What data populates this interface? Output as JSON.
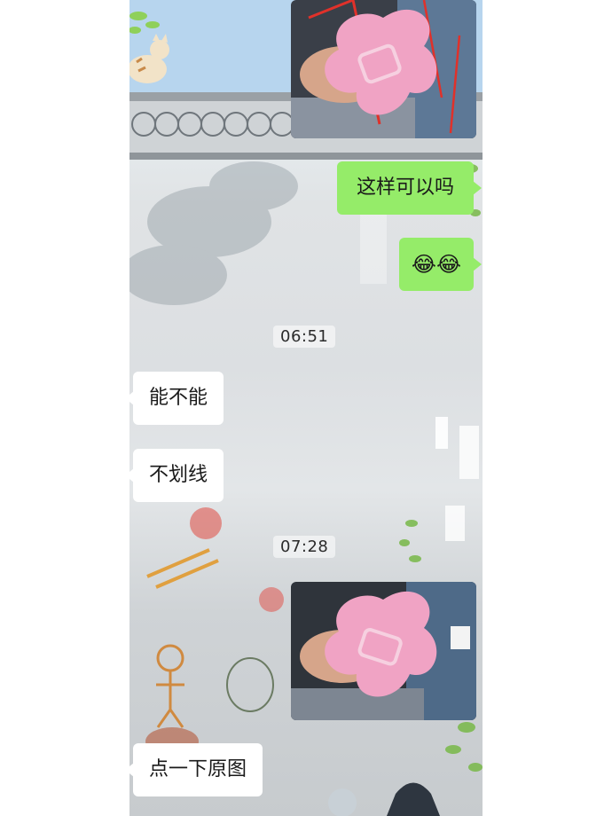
{
  "chat": {
    "messages": [
      {
        "kind": "image",
        "side": "out",
        "description_icon": "photo-with-sticker-icon"
      },
      {
        "kind": "text",
        "side": "out",
        "text": "这样可以吗"
      },
      {
        "kind": "emoji",
        "side": "out",
        "text": "😂😂"
      },
      {
        "kind": "time",
        "text": "06:51"
      },
      {
        "kind": "text",
        "side": "in",
        "text": "能不能"
      },
      {
        "kind": "text",
        "side": "in",
        "text": "不划线"
      },
      {
        "kind": "time",
        "text": "07:28"
      },
      {
        "kind": "image",
        "side": "out",
        "description_icon": "photo-with-sticker-icon"
      },
      {
        "kind": "text",
        "side": "in",
        "text": "点一下原图"
      }
    ]
  },
  "colors": {
    "outgoing_bubble": "#95ec69",
    "incoming_bubble": "#ffffff",
    "sticker_pink": "#f0a3c4",
    "mark_red": "#e0312a"
  }
}
